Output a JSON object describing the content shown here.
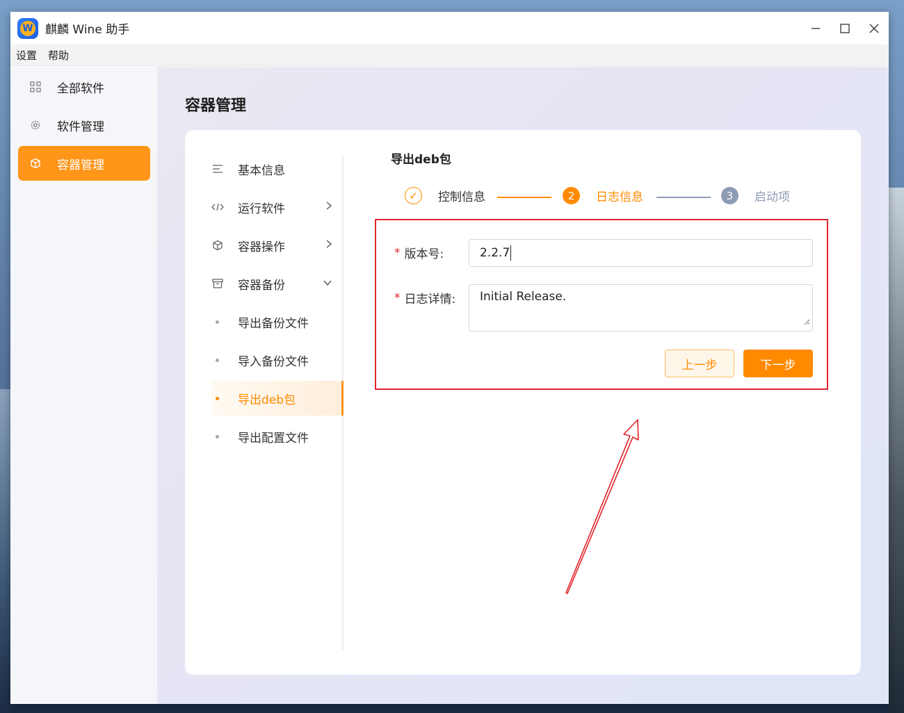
{
  "window": {
    "title": "麒麟 Wine 助手",
    "logo_letter": "W",
    "controls": {
      "minimize": "—",
      "maximize": "☐",
      "close": "✕"
    }
  },
  "menubar": {
    "items": [
      "设置",
      "帮助"
    ]
  },
  "sidebar": {
    "items": [
      {
        "label": "全部软件",
        "icon": "grid-icon"
      },
      {
        "label": "软件管理",
        "icon": "gear-icon"
      },
      {
        "label": "容器管理",
        "icon": "cube-icon",
        "active": true
      }
    ]
  },
  "page": {
    "title": "容器管理"
  },
  "subnav": {
    "items": [
      {
        "label": "基本信息",
        "icon": "lines-icon"
      },
      {
        "label": "运行软件",
        "icon": "code-icon",
        "chevron": ">"
      },
      {
        "label": "容器操作",
        "icon": "cube-icon",
        "chevron": ">"
      },
      {
        "label": "容器备份",
        "icon": "archive-icon",
        "chevron": "∨"
      },
      {
        "label": "导出备份文件"
      },
      {
        "label": "导入备份文件"
      },
      {
        "label": "导出deb包",
        "active": true
      },
      {
        "label": "导出配置文件"
      }
    ]
  },
  "content": {
    "title": "导出deb包",
    "steps": [
      {
        "label": "控制信息",
        "state": "done",
        "marker": "✓"
      },
      {
        "label": "日志信息",
        "state": "active",
        "marker": "2"
      },
      {
        "label": "启动项",
        "state": "pending",
        "marker": "3"
      }
    ],
    "form": {
      "required_mark": "*",
      "version_label": "版本号:",
      "version_value": "2.2.7",
      "log_label": "日志详情:",
      "log_value": "Initial Release.",
      "prev_button": "上一步",
      "next_button": "下一步"
    }
  },
  "colors": {
    "accent": "#ff9519",
    "accent_text": "#ff8a00",
    "annotation": "#e0242b",
    "step_pending": "#8e9bb5"
  }
}
